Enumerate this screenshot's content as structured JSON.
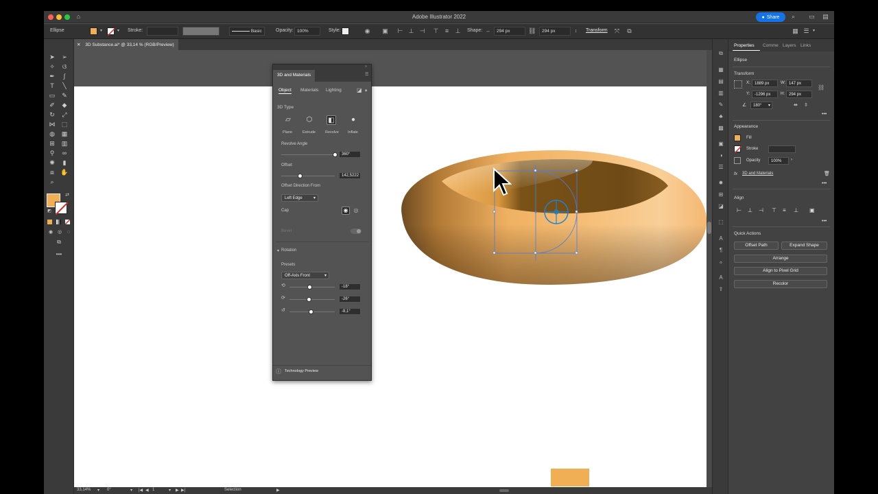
{
  "app": {
    "title": "Adobe Illustrator 2022",
    "share_label": "Share"
  },
  "colors": {
    "fill": "#f0ae55",
    "accent": "#1473e6",
    "stroke_none": "#d42c2c"
  },
  "control_bar": {
    "object_type": "Ellipse",
    "stroke_label": "Stroke:",
    "brush_label": "Basic",
    "opacity_label": "Opacity:",
    "opacity_value": "100%",
    "style_label": "Style:",
    "shape_label": "Shape:",
    "width_value": "294 px",
    "height_value": "294 px",
    "transform_label": "Transform"
  },
  "document_tab": {
    "label": "3D Substance.ai* @ 33,14 % (RGB/Preview)"
  },
  "status_bar": {
    "zoom": "33,14%",
    "rotation": "0°",
    "artboard": "1",
    "tool": "Selection"
  },
  "panel_3d": {
    "title": "3D and Materials",
    "tabs": [
      "Object",
      "Materials",
      "Lighting"
    ],
    "active_tab": "Object",
    "type_heading": "3D Type",
    "types": [
      "Plane",
      "Extrude",
      "Revolve",
      "Inflate"
    ],
    "active_type": "Revolve",
    "revolve_angle_label": "Revolve Angle",
    "revolve_angle_value": "360°",
    "offset_label": "Offset",
    "offset_value": "142,5222",
    "offset_from_label": "Offset Direction From",
    "offset_from_value": "Left Edge",
    "cap_label": "Cap",
    "bevel_label": "Bevel",
    "rotation_label": "Rotation",
    "presets_label": "Presets",
    "preset_value": "Off-Axis Front",
    "rotation_x": "-18°",
    "rotation_y": "-26°",
    "rotation_z": "-8,1°",
    "footer": "Technology Preview",
    "revolve_angle_fraction": 1.0,
    "offset_fraction": 0.35,
    "rotation_x_fraction": 0.45,
    "rotation_y_fraction": 0.43,
    "rotation_z_fraction": 0.48
  },
  "properties": {
    "tabs": [
      "Properties",
      "Comme",
      "Layers",
      "Links"
    ],
    "active_tab": "Properties",
    "object_type": "Ellipse",
    "transform_heading": "Transform",
    "x_label": "X:",
    "x_value": "1889 px",
    "y_label": "Y:",
    "y_value": "-1296 px",
    "w_label": "W:",
    "w_value": "147 px",
    "h_label": "H:",
    "h_value": "294 px",
    "angle_value": "180°",
    "appearance_heading": "Appearance",
    "fill_label": "Fill",
    "stroke_label": "Stroke",
    "opacity_label": "Opacity",
    "opacity_value": "100%",
    "effect_label": "3D and Materials",
    "align_heading": "Align",
    "quick_actions_heading": "Quick Actions",
    "actions": [
      "Offset Path",
      "Expand Shape",
      "Arrange",
      "Align to Pixel Grid",
      "Recolor"
    ]
  }
}
